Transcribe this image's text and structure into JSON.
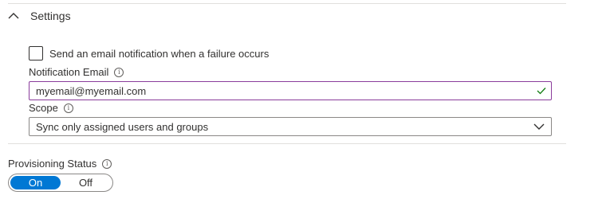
{
  "settings_section": {
    "title": "Settings",
    "email_checkbox": {
      "label": "Send an email notification when a failure occurs",
      "checked": false
    },
    "notification_email": {
      "label": "Notification Email",
      "value": "myemail@myemail.com"
    },
    "scope": {
      "label": "Scope",
      "selected": "Sync only assigned users and groups"
    }
  },
  "provisioning": {
    "label": "Provisioning Status",
    "on_label": "On",
    "off_label": "Off",
    "state": "On"
  },
  "colors": {
    "accent": "#0078d4",
    "field_focus": "#8a3c9b",
    "valid_check": "#107c10",
    "border": "#8a8886",
    "text": "#323130"
  }
}
